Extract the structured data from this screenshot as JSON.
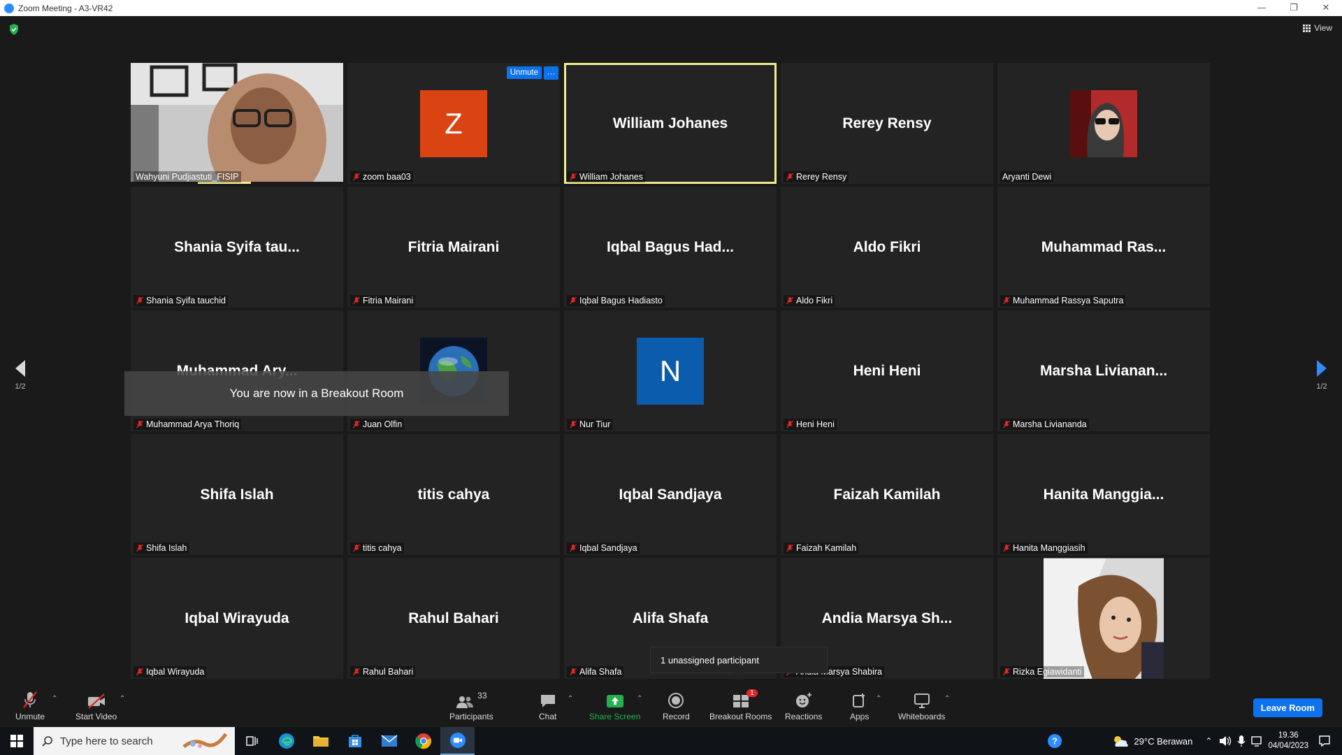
{
  "window": {
    "title": "Zoom Meeting - A3-VR42",
    "minimize": "—",
    "restore": "❐",
    "close": "✕"
  },
  "view_label": "View",
  "tiles": [
    {
      "kind": "video",
      "photo": "woman-hijab-glasses",
      "label": "Wahyuni Pudjiastuti_FISIP",
      "muted": false
    },
    {
      "kind": "letter",
      "letter": "Z",
      "color": "#d94412",
      "label": "zoom baa03",
      "muted": true
    },
    {
      "kind": "name",
      "big": "William Johanes",
      "label": "William Johanes",
      "muted": true,
      "active": true
    },
    {
      "kind": "name",
      "big": "Rerey Rensy",
      "label": "Rerey Rensy",
      "muted": true
    },
    {
      "kind": "photo",
      "photo": "woman-sunglasses",
      "label": "Aryanti Dewi",
      "muted": false
    },
    {
      "kind": "name",
      "big": "Shania  Syifa  tau...",
      "label": "Shania Syifa tauchid",
      "muted": true
    },
    {
      "kind": "name",
      "big": "Fitria Mairani",
      "label": "Fitria Mairani",
      "muted": true
    },
    {
      "kind": "name",
      "big": "Iqbal Bagus Had...",
      "label": "Iqbal Bagus Hadiasto",
      "muted": true
    },
    {
      "kind": "name",
      "big": "Aldo Fikri",
      "label": "Aldo Fikri",
      "muted": true
    },
    {
      "kind": "name",
      "big": "Muhammad  Ras...",
      "label": "Muhammad Rassya Saputra",
      "muted": true
    },
    {
      "kind": "name",
      "big": "Muhammad  Ary...",
      "label": "Muhammad Arya Thoriq",
      "muted": true
    },
    {
      "kind": "photo",
      "photo": "globe",
      "label": "Juan Olfin",
      "muted": true
    },
    {
      "kind": "letter",
      "letter": "N",
      "color": "#0b5cad",
      "label": "Nur Tiur",
      "muted": true
    },
    {
      "kind": "name",
      "big": "Heni Heni",
      "label": "Heni Heni",
      "muted": true
    },
    {
      "kind": "name",
      "big": "Marsha  Livianan...",
      "label": "Marsha Liviananda",
      "muted": true
    },
    {
      "kind": "name",
      "big": "Shifa Islah",
      "label": "Shifa Islah",
      "muted": true
    },
    {
      "kind": "name",
      "big": "titis cahya",
      "label": "titis cahya",
      "muted": true
    },
    {
      "kind": "name",
      "big": "Iqbal Sandjaya",
      "label": "Iqbal Sandjaya",
      "muted": true
    },
    {
      "kind": "name",
      "big": "Faizah Kamilah",
      "label": "Faizah Kamilah",
      "muted": true
    },
    {
      "kind": "name",
      "big": "Hanita  Manggia...",
      "label": "Hanita Manggiasih",
      "muted": true
    },
    {
      "kind": "name",
      "big": "Iqbal Wirayuda",
      "label": "Iqbal Wirayuda",
      "muted": true
    },
    {
      "kind": "name",
      "big": "Rahul Bahari",
      "label": "Rahul Bahari",
      "muted": true
    },
    {
      "kind": "name",
      "big": "Alifa Shafa",
      "label": "Alifa Shafa",
      "muted": true
    },
    {
      "kind": "name",
      "big": "Andia  Marsya  Sh...",
      "label": "Andia Marsya Shabira",
      "muted": true
    },
    {
      "kind": "photo",
      "photo": "woman-lying",
      "label": "Rizka Egiawidanti",
      "muted": true
    }
  ],
  "tile_overlay": {
    "unmute": "Unmute",
    "more": "···"
  },
  "pagination": {
    "left": "1/2",
    "right": "1/2"
  },
  "toast": "You are now in a Breakout Room",
  "tooltip": "1 unassigned participant",
  "toolbar": {
    "unmute": "Unmute",
    "start_video": "Start Video",
    "participants": "Participants",
    "participants_count": "33",
    "chat": "Chat",
    "share_screen": "Share Screen",
    "record": "Record",
    "breakout_rooms": "Breakout Rooms",
    "breakout_badge": "1",
    "reactions": "Reactions",
    "apps": "Apps",
    "whiteboards": "Whiteboards",
    "leave": "Leave Room"
  },
  "taskbar": {
    "search_placeholder": "Type here to search",
    "weather": "29°C  Berawan",
    "time": "19.36",
    "date": "04/04/2023"
  },
  "colors": {
    "accent": "#0e72ed",
    "active_speaker": "#f0eb8d",
    "muted_red": "#e02828"
  }
}
